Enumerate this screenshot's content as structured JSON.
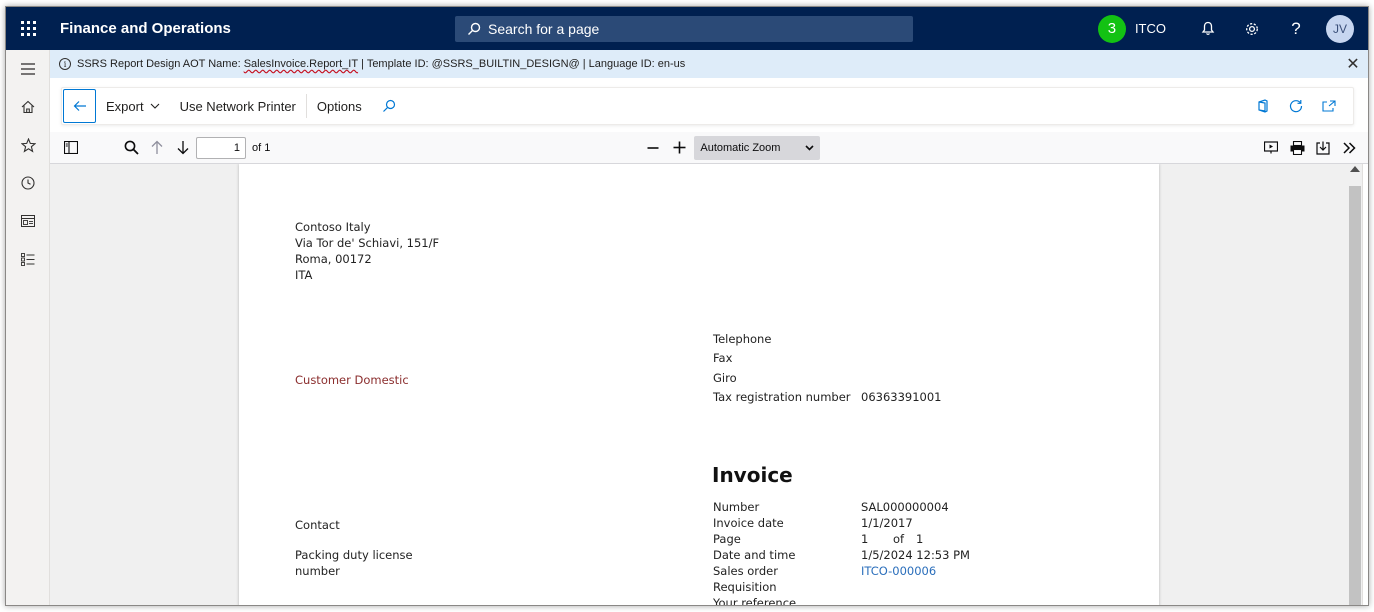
{
  "app": {
    "title": "Finance and Operations"
  },
  "search": {
    "placeholder": "Search for a page"
  },
  "header": {
    "notification_count": "3",
    "company": "ITCO",
    "avatar_initials": "JV"
  },
  "info_bar": {
    "prefix": "SSRS Report Design AOT Name: ",
    "report_name": "SalesInvoice.Report_IT",
    "suffix": " | Template ID: @SSRS_BUILTIN_DESIGN@ | Language ID: en-us"
  },
  "action_pane": {
    "export_label": "Export",
    "network_printer_label": "Use Network Printer",
    "options_label": "Options"
  },
  "pdf_toolbar": {
    "page_value": "1",
    "of_pages": "of 1",
    "zoom": "Automatic Zoom"
  },
  "invoice": {
    "company_address": [
      "Contoso Italy",
      "Via Tor de' Schiavi, 151/F",
      "Roma, 00172",
      "ITA"
    ],
    "customer_name": "Customer Domestic",
    "contact_fields": [
      {
        "label": "Telephone",
        "value": ""
      },
      {
        "label": "Fax",
        "value": ""
      },
      {
        "label": "Giro",
        "value": ""
      },
      {
        "label": "Tax registration number",
        "value": "06363391001"
      }
    ],
    "title": "Invoice",
    "contact_label": "Contact",
    "packing_label_1": "Packing duty license",
    "packing_label_2": "number",
    "details": {
      "number_label": "Number",
      "number_value": "SAL000000004",
      "date_label": "Invoice date",
      "date_value": "1/1/2017",
      "page_label": "Page",
      "page_value": "1",
      "page_of": "of",
      "page_total": "1",
      "datetime_label": "Date and time",
      "datetime_value": "1/5/2024 12:53 PM",
      "sales_order_label": "Sales order",
      "sales_order_value": "ITCO-000006",
      "requisition_label": "Requisition",
      "your_reference_label": "Your reference"
    }
  },
  "colors": {
    "nav_bg": "#002050",
    "accent": "#0078d4",
    "badge": "#13c213",
    "info_bg": "#deecf9",
    "customer": "#8b2e2e",
    "link": "#2a6ebb"
  }
}
